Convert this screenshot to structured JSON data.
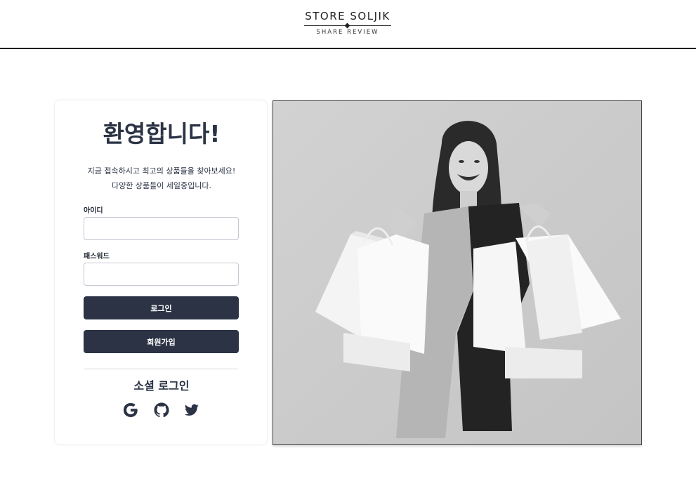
{
  "header": {
    "logo_main": "STORE SOLJIK",
    "logo_sub": "SHARE REVIEW"
  },
  "login": {
    "welcome": "환영합니다!",
    "desc_line1": "지금 접속하시고 최고의 상품들을 찾아보세요!",
    "desc_line2": "다양한 상품들이 세일중입니다.",
    "id_label": "아이디",
    "id_value": "",
    "password_label": "패스워드",
    "password_value": "",
    "login_button": "로그인",
    "signup_button": "회원가입",
    "social_title": "소셜 로그인",
    "social_icons": [
      "google-icon",
      "github-icon",
      "twitter-icon"
    ]
  },
  "colors": {
    "primary": "#2b3345",
    "border": "#c6c6d3"
  }
}
